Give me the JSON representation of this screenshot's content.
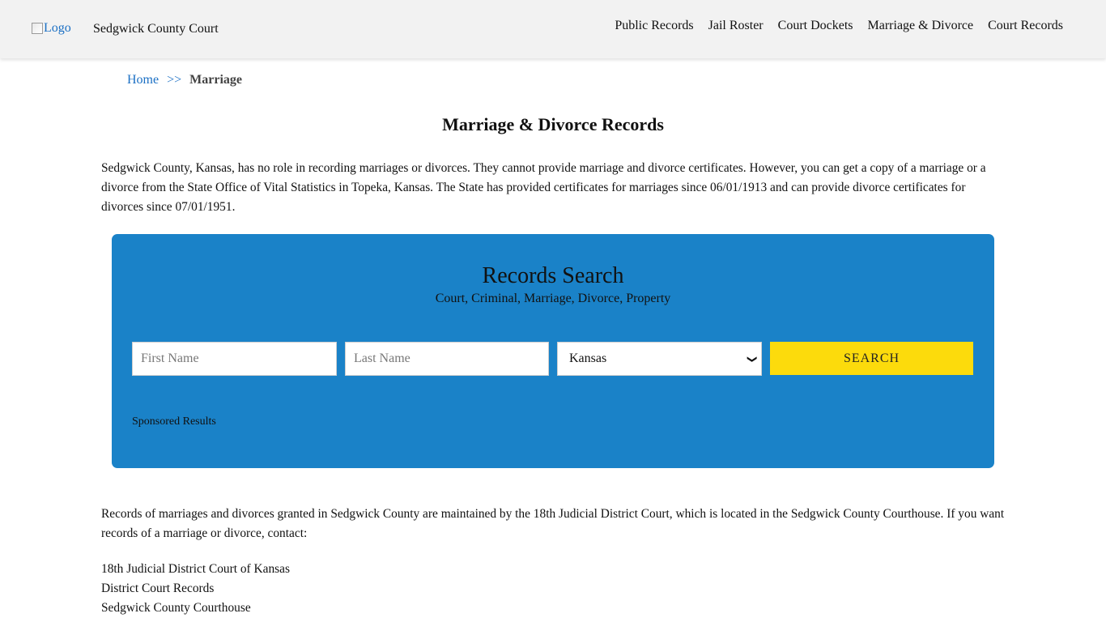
{
  "header": {
    "logo_alt": "Logo",
    "site_title": "Sedgwick County Court",
    "nav": [
      {
        "label": "Public Records"
      },
      {
        "label": "Jail Roster"
      },
      {
        "label": "Court Dockets"
      },
      {
        "label": "Marriage & Divorce"
      },
      {
        "label": "Court Records"
      }
    ]
  },
  "breadcrumb": {
    "home": "Home",
    "separator": ">>",
    "current": "Marriage"
  },
  "page_title": "Marriage & Divorce Records",
  "intro": "Sedgwick County, Kansas, has no role in recording marriages or divorces. They cannot provide marriage and divorce certificates. However, you can get a copy of a marriage or a divorce from the State Office of Vital Statistics in Topeka, Kansas. The State has provided certificates for marriages since 06/01/1913 and can provide divorce certificates for divorces since 07/01/1951.",
  "search": {
    "title": "Records Search",
    "subtitle": "Court, Criminal, Marriage, Divorce, Property",
    "first_name_placeholder": "First Name",
    "last_name_placeholder": "Last Name",
    "state_selected": "Kansas",
    "button_label": "SEARCH",
    "sponsored": "Sponsored Results",
    "bg_color": "#1a82c8",
    "button_color": "#fcdb0c"
  },
  "records_para": "Records of marriages and divorces granted in Sedgwick County are maintained by the 18th Judicial District Court, which is located in the Sedgwick County Courthouse. If you want records of a marriage or divorce, contact:",
  "address": [
    "18th Judicial District Court of Kansas",
    "District Court Records",
    "Sedgwick County Courthouse"
  ]
}
